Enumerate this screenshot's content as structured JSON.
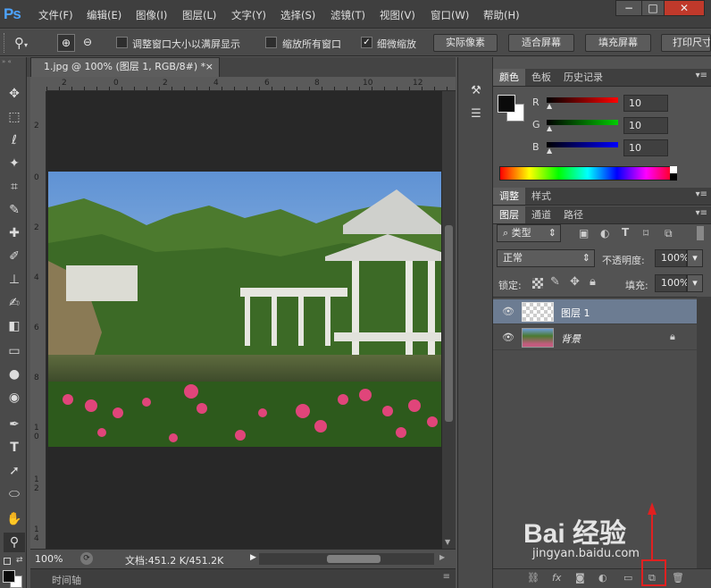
{
  "app": {
    "logo": "Ps"
  },
  "menu": [
    "文件(F)",
    "编辑(E)",
    "图像(I)",
    "图层(L)",
    "文字(Y)",
    "选择(S)",
    "滤镜(T)",
    "视图(V)",
    "窗口(W)",
    "帮助(H)"
  ],
  "window_controls": {
    "minimize": "−",
    "restore": "□",
    "close": "✕"
  },
  "options": {
    "resize_windows_label": "调整窗口大小以满屏显示",
    "zoom_all_label": "缩放所有窗口",
    "scrubby_zoom_label": "细微缩放",
    "actual_pixels": "实际像素",
    "fit_screen": "适合屏幕",
    "fill_screen": "填充屏幕",
    "print_size": "打印尺寸"
  },
  "document": {
    "tab_title": "1.jpg @ 100% (图层 1, RGB/8#) *",
    "close": "×",
    "zoom": "100%",
    "doc_size": "文档:451.2 K/451.2K"
  },
  "rulers": {
    "h_ticks": [
      "2",
      "0",
      "2",
      "4",
      "6",
      "8",
      "10",
      "12",
      "14",
      "16"
    ],
    "v_ticks": [
      "2",
      "0",
      "2",
      "4",
      "6",
      "8",
      "1\n0",
      "1\n2",
      "1\n4"
    ]
  },
  "timeline": {
    "label": "时间轴"
  },
  "color_panel": {
    "tabs": [
      "颜色",
      "色板",
      "历史记录"
    ],
    "channels": [
      {
        "name": "R",
        "value": "10"
      },
      {
        "name": "G",
        "value": "10"
      },
      {
        "name": "B",
        "value": "10"
      }
    ],
    "colors": {
      "foreground": "#0a0a0a",
      "background": "#ffffff",
      "r_track": "#ff0000",
      "g_track": "#00c000",
      "b_track": "#0000ff"
    }
  },
  "adjust_panel": {
    "tabs": [
      "调整",
      "样式"
    ]
  },
  "layers_panel": {
    "tabs": [
      "图层",
      "通道",
      "路径"
    ],
    "filter_label": "类型",
    "blend_mode": "正常",
    "opacity_label": "不透明度:",
    "opacity_value": "100%",
    "lock_label": "锁定:",
    "fill_label": "填充:",
    "fill_value": "100%",
    "layers": [
      {
        "name": "图层 1",
        "selected": true,
        "locked": false
      },
      {
        "name": "背景",
        "selected": false,
        "locked": true
      }
    ]
  },
  "watermark": {
    "brand": "Bai 经验",
    "url": "jingyan.baidu.com"
  }
}
